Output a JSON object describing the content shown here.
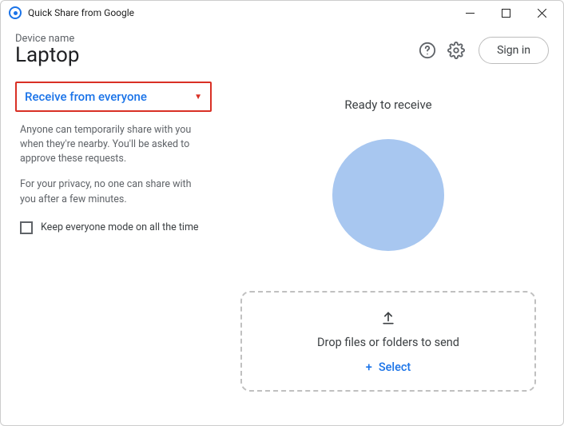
{
  "window": {
    "title": "Quick Share from Google"
  },
  "header": {
    "device_label": "Device name",
    "device_name": "Laptop",
    "signin_label": "Sign in"
  },
  "sidebar": {
    "dropdown_label": "Receive from everyone",
    "desc_1": "Anyone can temporarily share with you when they're nearby. You'll be asked to approve these requests.",
    "desc_2": "For your privacy, no one can share with you after a few minutes.",
    "checkbox_label": "Keep everyone mode on all the time",
    "checkbox_checked": false
  },
  "main": {
    "status": "Ready to receive",
    "dropzone_text": "Drop files or folders to send",
    "select_label": "Select"
  }
}
